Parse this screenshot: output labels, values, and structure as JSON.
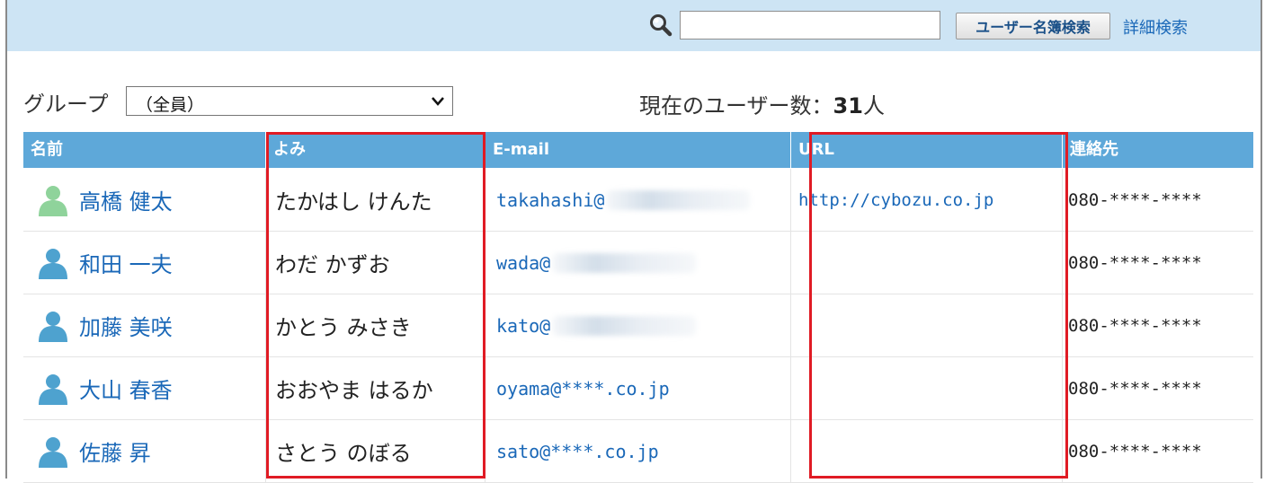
{
  "search": {
    "value": "",
    "button_label": "ユーザー名簿検索",
    "advanced_link": "詳細検索"
  },
  "filter": {
    "group_label": "グループ",
    "group_selected": "（全員）",
    "count_label": "現在のユーザー数：",
    "count_value": "31",
    "count_unit": "人"
  },
  "table": {
    "headers": [
      "名前",
      "よみ",
      "E-mail",
      "URL",
      "連絡先"
    ],
    "rows": [
      {
        "name": "高橋 健太",
        "yomi": "たかはし けんた",
        "email": "takahashi@",
        "email_blurred": true,
        "url": "http://cybozu.co.jp",
        "contact": "080-****-****",
        "avatar_color": "#8fd39b"
      },
      {
        "name": "和田 一夫",
        "yomi": "わだ かずお",
        "email": "wada@",
        "email_blurred": true,
        "url": "",
        "contact": "080-****-****",
        "avatar_color": "#4ea2cf"
      },
      {
        "name": "加藤 美咲",
        "yomi": "かとう みさき",
        "email": "kato@",
        "email_blurred": true,
        "url": "",
        "contact": "080-****-****",
        "avatar_color": "#4ea2cf"
      },
      {
        "name": "大山 春香",
        "yomi": "おおやま はるか",
        "email": "oyama@****.co.jp",
        "email_blurred": false,
        "url": "",
        "contact": "080-****-****",
        "avatar_color": "#4ea2cf"
      },
      {
        "name": "佐藤 昇",
        "yomi": "さとう のぼる",
        "email": "sato@****.co.jp",
        "email_blurred": false,
        "url": "",
        "contact": "080-****-****",
        "avatar_color": "#4ea2cf"
      }
    ]
  },
  "colors": {
    "topbar_bg": "#cde4f4",
    "header_bg": "#5ea8d9",
    "link": "#1a68b8",
    "highlight": "#e01b24"
  }
}
